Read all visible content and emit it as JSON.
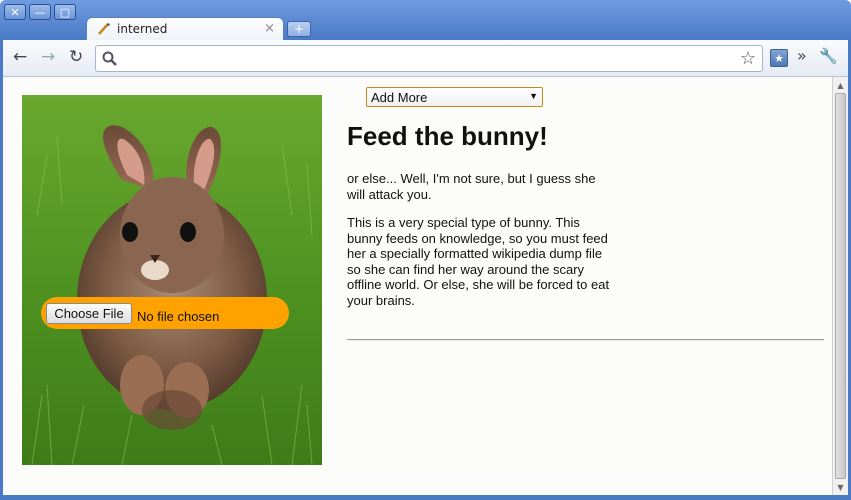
{
  "window": {
    "buttons": {
      "close": "✕",
      "minimize": "—",
      "maximize": "▢"
    }
  },
  "tab": {
    "title": "interned",
    "close": "×",
    "new_tab": "+"
  },
  "toolbar": {
    "back": "←",
    "forward": "→",
    "reload": "↻",
    "url": "",
    "star": "☆",
    "bookmark_icon": "★",
    "chevron": "»",
    "wrench": "🔧"
  },
  "page": {
    "dropdown": {
      "selected": "Add More"
    },
    "title": "Feed the bunny!",
    "paragraph1": "or else... Well, I'm not sure, but I guess she will attack you.",
    "paragraph2": "This is a very special type of bunny. This bunny feeds on knowledge, so you must feed her a specially formatted wikipedia dump file so she can find her way around the scary offline world. Or else, she will be forced to eat your brains.",
    "file_input": {
      "button_label": "Choose File",
      "status": "No file chosen"
    }
  },
  "colors": {
    "file_pill": "#ffa200",
    "select_border": "#c48a1c",
    "grass": "#4d8f1e"
  }
}
